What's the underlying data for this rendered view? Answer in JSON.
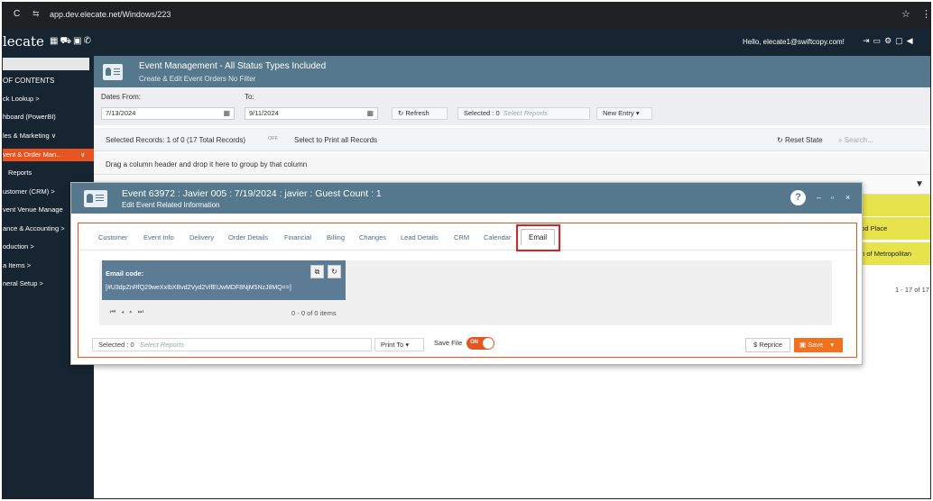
{
  "browser": {
    "url": "app.dev.elecate.net/Windows/223"
  },
  "app": {
    "logo": "lecate",
    "greeting": "Hello, elecate1@swiftcopy.com!"
  },
  "sidebar": {
    "title": "OF CONTENTS",
    "items": [
      {
        "label": "ck Lookup",
        "chevron": ">"
      },
      {
        "label": "hboard (PowerBI)",
        "chevron": ""
      },
      {
        "label": "les & Marketing",
        "chevron": "∨"
      },
      {
        "label": "vent & Order Man...",
        "chevron": "∨"
      },
      {
        "label": "Reports",
        "chevron": ""
      },
      {
        "label": "ustomer (CRM)",
        "chevron": ">"
      },
      {
        "label": "vent Venue Manage",
        "chevron": ""
      },
      {
        "label": "ance & Accounting",
        "chevron": ">"
      },
      {
        "label": "oduction",
        "chevron": ">"
      },
      {
        "label": "a Items",
        "chevron": ">"
      },
      {
        "label": "neral Setup",
        "chevron": ">"
      }
    ]
  },
  "page": {
    "title": "Event Management - All Status Types Included",
    "subtitle": "Create & Edit Event Orders No Filter"
  },
  "filters": {
    "dates_from_label": "Dates From:",
    "to_label": "To:",
    "date_from": "7/13/2024",
    "date_to": "9/11/2024",
    "refresh_label": "Refresh",
    "selected_label": "Selected : 0",
    "select_reports_placeholder": "Select Reports",
    "new_entry_label": "New Entry"
  },
  "grid": {
    "selected_records": "Selected Records: 1 of 0 (17 Total Records)",
    "toggle_off": "OFF",
    "select_to_print": "Select to Print all Records",
    "reset_state": "Reset State",
    "search_placeholder": "Search...",
    "group_hint": "Drag a column header and drop it here to group by that column",
    "right_rows": [
      "ood Place",
      "en of Metropolitan"
    ],
    "pager_right": "1 - 17 of 17"
  },
  "modal": {
    "title": "Event 63972 : Javier 005 : 7/19/2024 : javier : Guest Count : 1",
    "subtitle": "Edit Event Related Information",
    "help": "?",
    "tabs": [
      "Customer",
      "Event Info",
      "Delivery",
      "Order Details",
      "Financial",
      "Billing",
      "Changes",
      "Lead Details",
      "CRM",
      "Calendar"
    ],
    "active_tab": "Email",
    "email_code_label": "Email code:",
    "email_code_value": "[#U3dpZnRfQ29weXxIbXBvd2Vyd2VifEUwMDF8NjM5NzJ8MQ==]",
    "pager_info": "0 - 0 of 0 items",
    "footer": {
      "selected": "Selected : 0",
      "select_reports_placeholder": "Select Reports",
      "print_to": "Print To",
      "save_file": "Save File",
      "toggle_on": "ON",
      "reprice": "$ Reprice",
      "save": "Save"
    }
  },
  "colors": {
    "navy": "#162531",
    "header_blue": "#55788d",
    "accent_orange": "#e8541f",
    "highlight_red": "#e02020",
    "yellow": "#e7e34d"
  }
}
